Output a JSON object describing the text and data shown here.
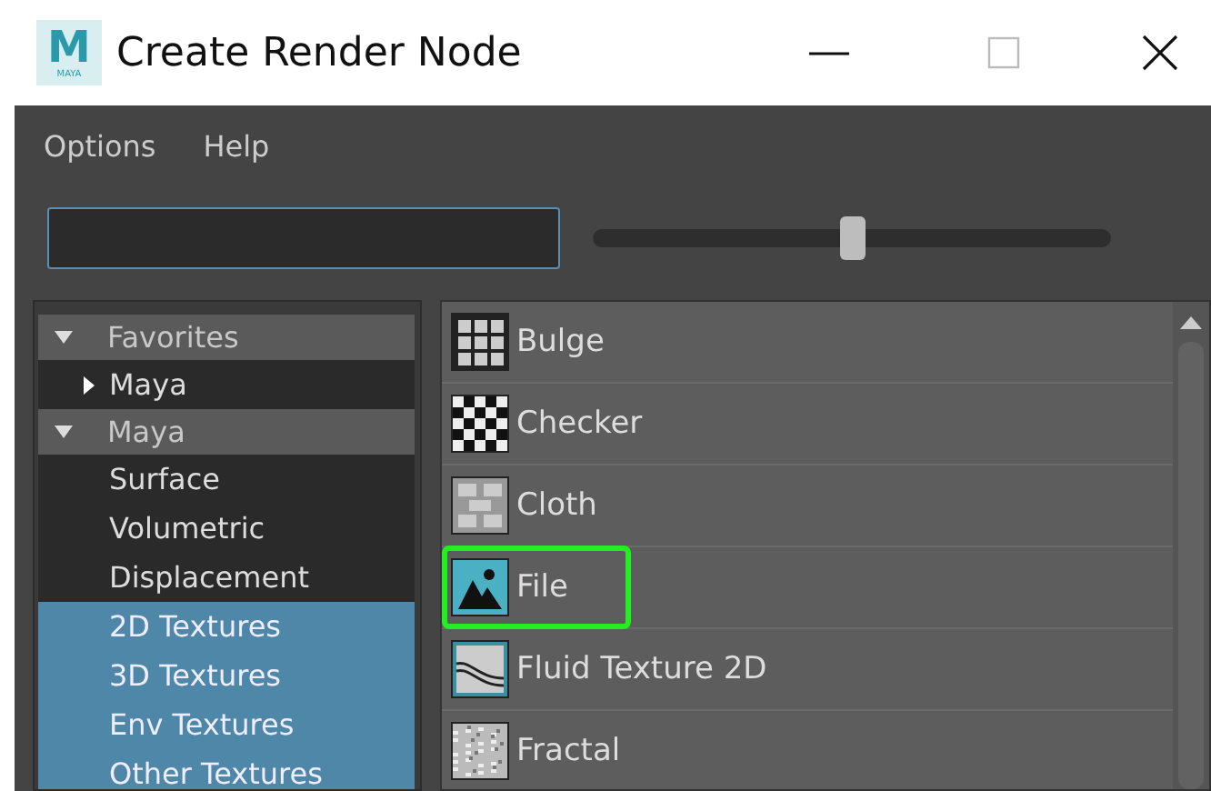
{
  "window": {
    "title": "Create Render Node",
    "logo_text": "M",
    "logo_subtext": "MAYA"
  },
  "menu": [
    "Options",
    "Help"
  ],
  "slider": {
    "level": 0.5
  },
  "tree": [
    {
      "label": "Favorites",
      "expanded": true,
      "children": [
        {
          "label": "Maya",
          "expanded": false,
          "selected": false
        }
      ]
    },
    {
      "label": "Maya",
      "expanded": true,
      "children": [
        {
          "label": "Surface",
          "selected": false
        },
        {
          "label": "Volumetric",
          "selected": false
        },
        {
          "label": "Displacement",
          "selected": false
        },
        {
          "label": "2D Textures",
          "selected": true
        },
        {
          "label": "3D Textures",
          "selected": true
        },
        {
          "label": "Env Textures",
          "selected": true
        },
        {
          "label": "Other Textures",
          "selected": true
        }
      ]
    }
  ],
  "nodes": [
    {
      "label": "Bulge",
      "kind": "bulge",
      "circled": false
    },
    {
      "label": "Checker",
      "kind": "checker",
      "circled": false
    },
    {
      "label": "Cloth",
      "kind": "cloth",
      "circled": false
    },
    {
      "label": "File",
      "kind": "file",
      "circled": true
    },
    {
      "label": "Fluid Texture 2D",
      "kind": "fluid",
      "circled": false
    },
    {
      "label": "Fractal",
      "kind": "fractal",
      "circled": false
    }
  ]
}
